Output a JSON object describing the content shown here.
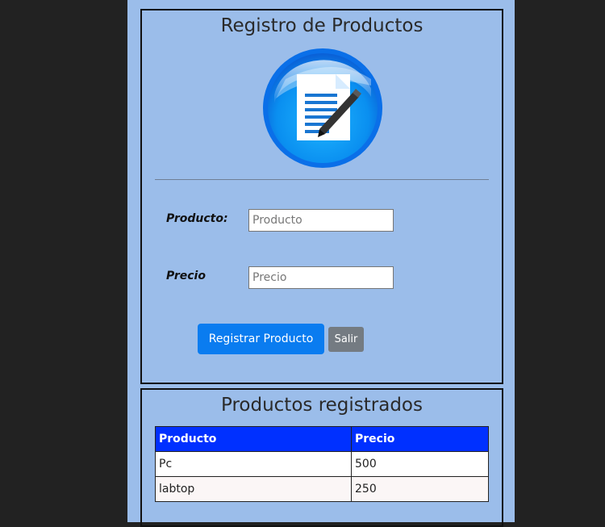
{
  "form": {
    "title": "Registro de Productos",
    "producto_label": "Producto:",
    "producto_placeholder": "Producto",
    "precio_label": "Precio",
    "precio_placeholder": "Precio",
    "register_button": "Registrar Producto",
    "exit_button": "Salir",
    "logo_icon": "document-pen-icon"
  },
  "list": {
    "title": "Productos registrados",
    "headers": [
      "Producto",
      "Precio"
    ],
    "rows": [
      [
        "Pc",
        "500"
      ],
      [
        "labtop",
        "250"
      ]
    ]
  },
  "colors": {
    "page_background": "#222222",
    "column_background": "#9bbdea",
    "primary_button": "#0a7cf0",
    "secondary_button": "#747b82",
    "table_header": "#0030ff"
  }
}
